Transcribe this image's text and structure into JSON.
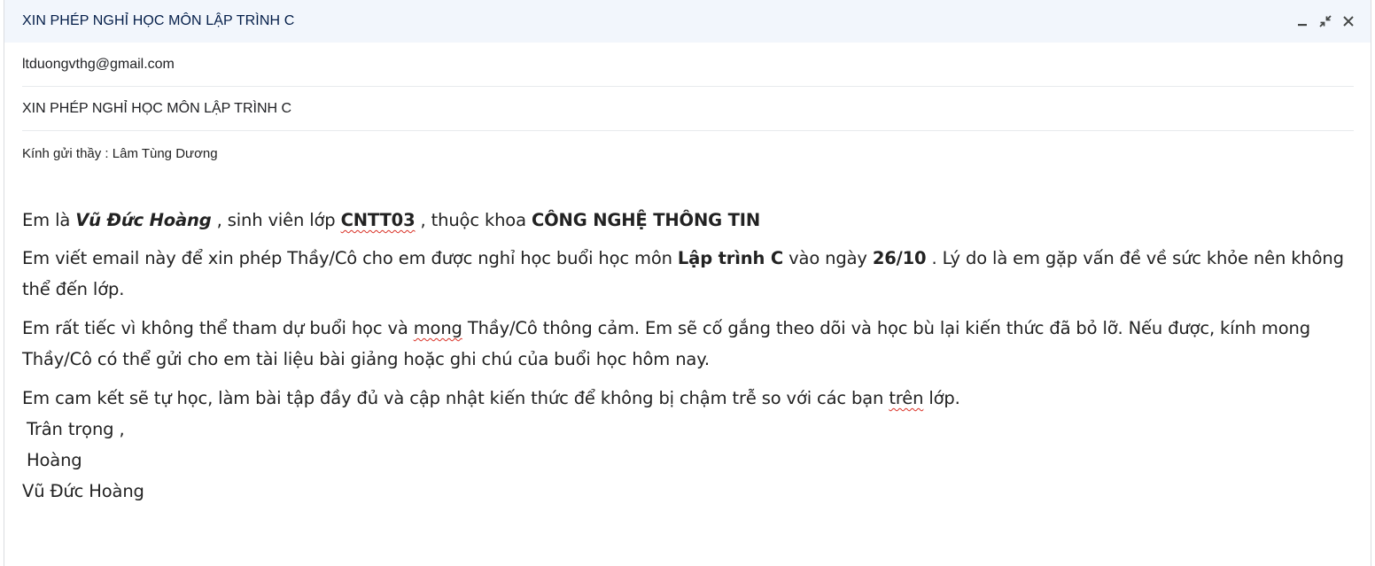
{
  "window": {
    "title": "XIN PHÉP NGHỈ HỌC MÔN LẬP TRÌNH C",
    "minimize_icon": "minimize-icon",
    "exit_fullscreen_icon": "exit-fullscreen-icon",
    "close_icon": "close-icon"
  },
  "recipients": {
    "to": "ltduongvthg@gmail.com"
  },
  "subject": "XIN PHÉP NGHỈ HỌC MÔN LẬP TRÌNH C",
  "body": {
    "greeting": "Kính gửi thầy : Lâm Tùng Dương",
    "p1": {
      "a": "Em là ",
      "name": "Vũ Đức Hoàng",
      "b": " , sinh viên lớp ",
      "class": "CNTT03",
      "c": " , thuộc khoa ",
      "faculty": "CÔNG NGHỆ THÔNG TIN"
    },
    "p2": {
      "a": "Em viết email này để xin phép Thầy/Cô cho em được nghỉ học buổi học môn ",
      "subject": "Lập trình C",
      "b": " vào ngày  ",
      "date": "26/10",
      "c": " . Lý do là em gặp vấn đề về sức khỏe nên không thể đến lớp."
    },
    "p3": {
      "a": "Em rất tiếc vì không thể tham dự buổi học và ",
      "mong": "mong",
      "b": " Thầy/Cô thông cảm. Em sẽ cố gắng theo dõi và học bù lại kiến thức đã bỏ lỡ. Nếu được, kính mong Thầy/Cô có thể gửi cho em tài liệu bài giảng hoặc ghi chú của buổi học hôm nay."
    },
    "p4": {
      "a": "Em cam kết sẽ tự học, làm bài tập đầy đủ và cập nhật kiến thức để không bị chậm trễ so với các bạn ",
      "tren": "trên",
      "b": " lớp."
    },
    "closing": "Trân trọng ,",
    "short_name": "Hoàng",
    "full_name": "Vũ Đức Hoàng"
  }
}
